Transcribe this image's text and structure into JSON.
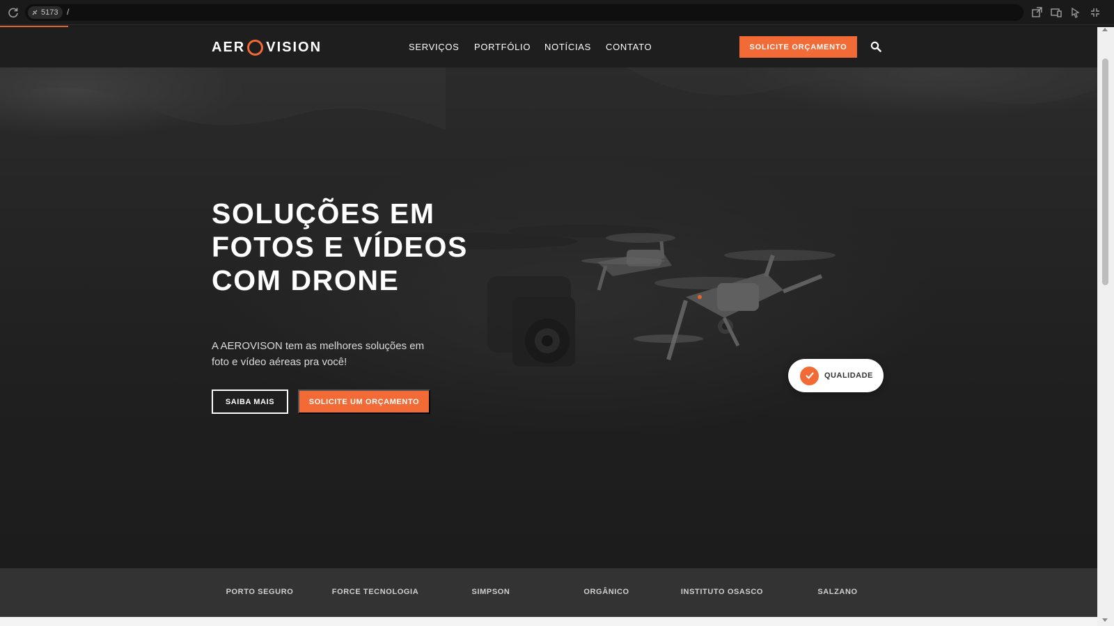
{
  "browser": {
    "port": "5173",
    "path": "/"
  },
  "brand": {
    "logo_left": "AER",
    "logo_right": "VISION",
    "accent": "#f26a35"
  },
  "nav": {
    "items": [
      "SERVIÇOS",
      "PORTFÓLIO",
      "NOTÍCIAS",
      "CONTATO"
    ],
    "cta": "SOLICITE ORÇAMENTO",
    "search_icon": "search-icon"
  },
  "hero": {
    "title_lines": [
      "SOLUÇÕES EM",
      "FOTOS E VÍDEOS",
      "COM DRONE"
    ],
    "subtitle_lines": [
      "A AEROVISON tem as melhores soluções em",
      "foto e vídeo aéreas pra você!"
    ],
    "btn_secondary": "SAIBA MAIS",
    "btn_primary": "SOLICITE UM ORÇAMENTO",
    "badge": "QUALIDADE"
  },
  "clients": [
    "PORTO SEGURO",
    "FORCE TECNOLOGIA",
    "SIMPSON",
    "ORGÂNICO",
    "INSTITUTO OSASCO",
    "SALZANO"
  ]
}
